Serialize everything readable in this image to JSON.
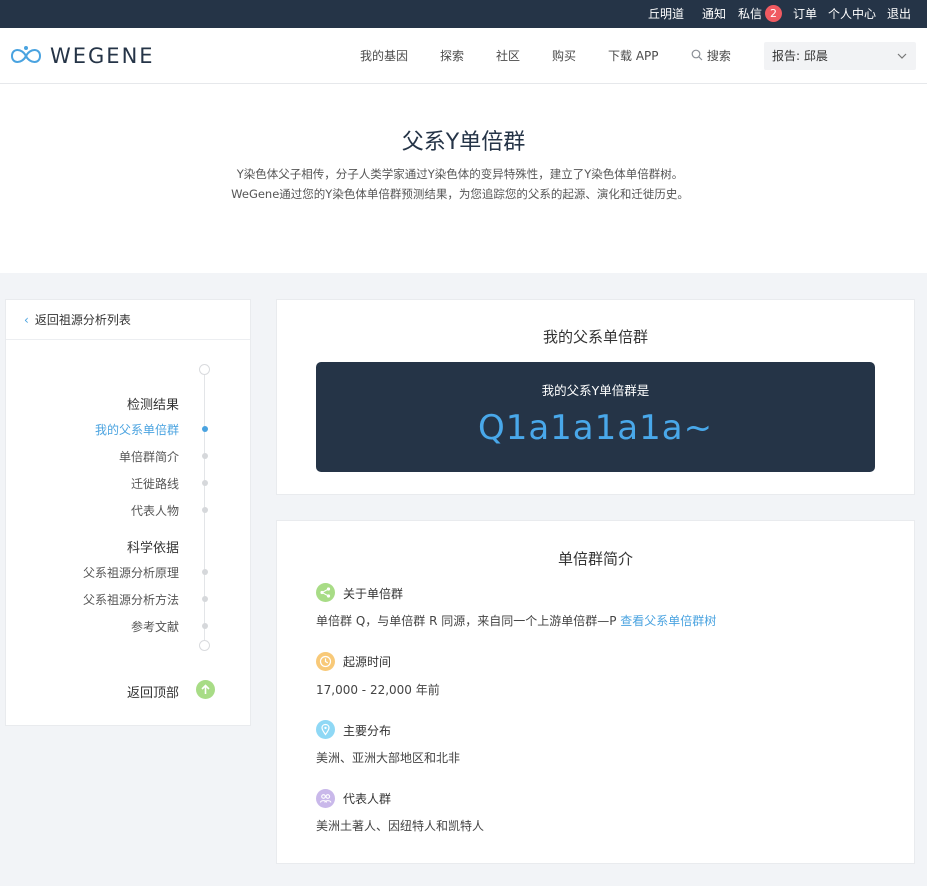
{
  "topbar": {
    "user_name": "丘明道",
    "notify": "通知",
    "messages": "私信",
    "messages_count": "2",
    "orders": "订单",
    "profile": "个人中心",
    "logout": "退出"
  },
  "nav": {
    "logo_text": "WEGENE",
    "links": [
      "我的基因",
      "探索",
      "社区",
      "购买",
      "下载 APP"
    ],
    "search_label": "搜索",
    "report_label": "报告: 邱晨"
  },
  "hero": {
    "title": "父系Y单倍群",
    "description": "Y染色体父子相传，分子人类学家通过Y染色体的变异特殊性，建立了Y染色体单倍群树。WeGene通过您的Y染色体单倍群预测结果，为您追踪您的父系的起源、演化和迁徙历史。"
  },
  "sidebar": {
    "back_label": "返回祖源分析列表",
    "section1": "检测结果",
    "items1": [
      "我的父系单倍群",
      "单倍群简介",
      "迁徙路线",
      "代表人物"
    ],
    "section2": "科学依据",
    "items2": [
      "父系祖源分析原理",
      "父系祖源分析方法",
      "参考文献"
    ],
    "back_top": "返回顶部"
  },
  "card1": {
    "title": "我的父系单倍群",
    "label": "我的父系Y单倍群是",
    "value": "Q1a1a1a1a~"
  },
  "card2": {
    "title": "单倍群简介",
    "about_head": "关于单倍群",
    "about_text": "单倍群 Q，与单倍群 R 同源，来自同一个上游单倍群—P",
    "about_link": "查看父系单倍群树",
    "origin_head": "起源时间",
    "origin_text": "17,000 - 22,000 年前",
    "dist_head": "主要分布",
    "dist_text": "美洲、亚洲大部地区和北非",
    "pop_head": "代表人群",
    "pop_text": "美洲土著人、因纽特人和凯特人"
  },
  "colors": {
    "dark_navy": "#253447",
    "accent_blue": "#4aa3e0",
    "badge_red": "#f05a61",
    "icon_green": "#a8dc86",
    "icon_orange": "#f8c978",
    "icon_cyan": "#8fd8f5",
    "icon_purple": "#c9b8ea"
  }
}
